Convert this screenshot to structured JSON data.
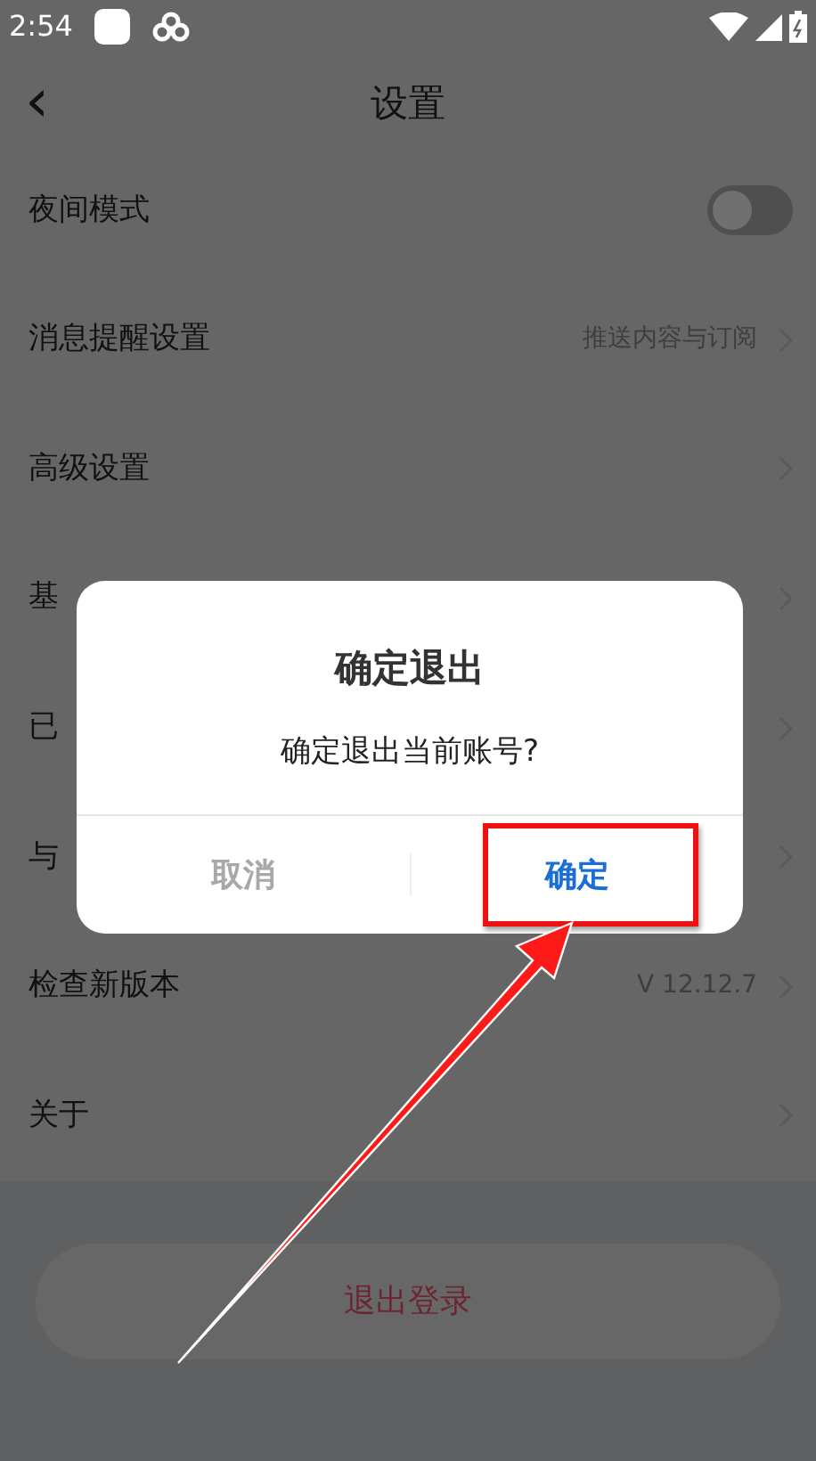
{
  "status_bar": {
    "time": "2:54"
  },
  "header": {
    "back": "‹",
    "title": "设置"
  },
  "rows": [
    {
      "kind": "toggle",
      "label": "夜间模式",
      "on": false
    },
    {
      "kind": "link",
      "label": "消息提醒设置",
      "value": "推送内容与订阅"
    },
    {
      "kind": "link",
      "label": "高级设置"
    },
    {
      "kind": "link",
      "label": "基"
    },
    {
      "kind": "link",
      "label": "已"
    },
    {
      "kind": "link",
      "label": "与"
    },
    {
      "kind": "link",
      "label": "检查新版本",
      "value": "V 12.12.7"
    },
    {
      "kind": "link",
      "label": "关于"
    }
  ],
  "logout_button": "退出登录",
  "dialog": {
    "title": "确定退出",
    "message": "确定退出当前账号?",
    "buttons": [
      {
        "label": "取消",
        "kind": "cancel"
      },
      {
        "label": "确定",
        "kind": "confirm"
      }
    ]
  }
}
